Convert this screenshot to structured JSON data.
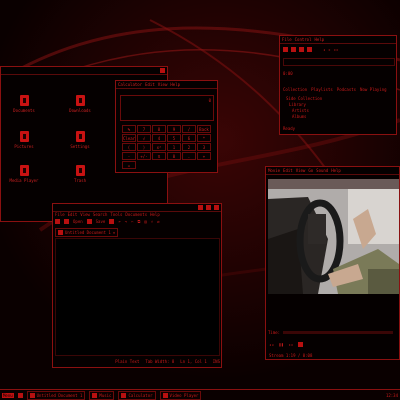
{
  "desktop": {
    "icons": [
      {
        "label": "Documents"
      },
      {
        "label": "Downloads"
      },
      {
        "label": "Pictures"
      },
      {
        "label": "Settings"
      },
      {
        "label": "Media Player"
      },
      {
        "label": "Trash"
      }
    ]
  },
  "calculator": {
    "title": "Calculator",
    "menu": [
      "Edit",
      "View",
      "Help"
    ],
    "display": "0",
    "buttons": [
      "%",
      "7",
      "8",
      "9",
      "/",
      "Back",
      "Clear",
      "√",
      "4",
      "5",
      "6",
      "*",
      "(",
      ")",
      "x²",
      "1",
      "2",
      "3",
      "-",
      "+/-",
      "π",
      "0",
      ".",
      "+",
      "="
    ]
  },
  "music": {
    "title": "Music",
    "menu": [
      "File",
      "Control",
      "Help"
    ],
    "time": "0:00",
    "sections": [
      "Collection",
      "Playlists",
      "Podcasts",
      "Now Playing"
    ],
    "tree": [
      "Side Collection",
      "Library",
      "Artists",
      "Albums",
      "Genres"
    ],
    "status": "Ready"
  },
  "editor": {
    "title": "Untitled Document 1",
    "menu": [
      "File",
      "Edit",
      "View",
      "Search",
      "Tools",
      "Documents",
      "Help"
    ],
    "toolbar": [
      "Open",
      "Save",
      "Undo",
      "Redo"
    ],
    "tab": "Untitled Document 1",
    "status": [
      "Plain Text",
      "Tab Width: 8",
      "Ln 1, Col 1",
      "INS"
    ]
  },
  "player": {
    "title": "Video Player",
    "menu": [
      "Movie",
      "Edit",
      "View",
      "Go",
      "Sound",
      "Help"
    ],
    "time_label": "Time:",
    "status": "Stream 1:19 / 0:08"
  },
  "taskbar": {
    "menu_label": "Menu",
    "tasks": [
      "Untitled Document 1",
      "Music",
      "Calculator",
      "Video Player"
    ],
    "clock": "12:34"
  },
  "colors": {
    "accent": "#c81212",
    "border": "#8a1010",
    "bg": "#050000"
  }
}
